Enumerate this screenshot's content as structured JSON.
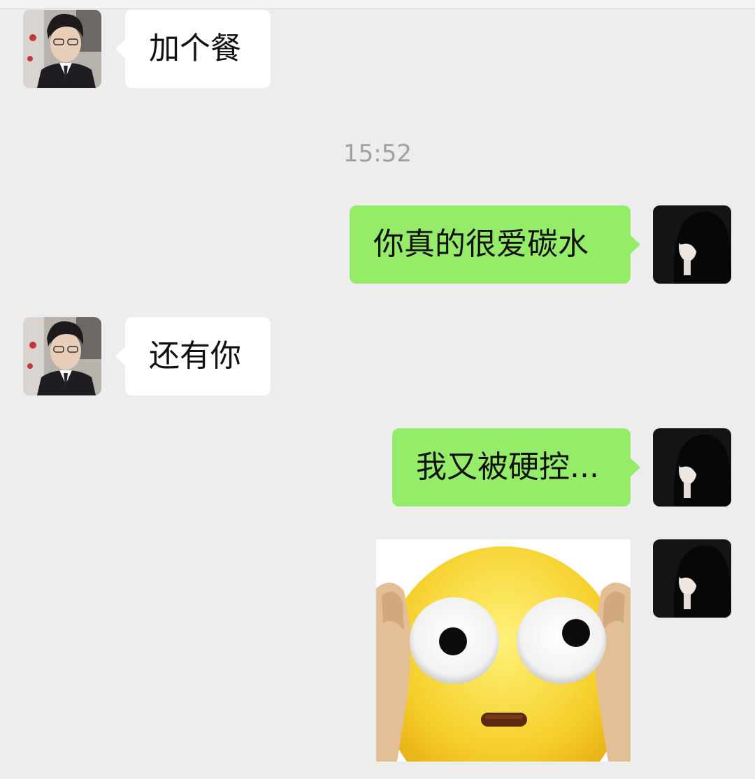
{
  "messages": [
    {
      "side": "left",
      "sender_avatar": "avatar-man-in-suit",
      "text": "加个餐"
    },
    {
      "type": "timestamp",
      "text": "15:52"
    },
    {
      "side": "right",
      "sender_avatar": "avatar-woman-dark-hair",
      "text": "你真的很爱碳水"
    },
    {
      "side": "left",
      "sender_avatar": "avatar-man-in-suit",
      "text": "还有你"
    },
    {
      "side": "right",
      "sender_avatar": "avatar-woman-dark-hair",
      "text": "我又被硬控..."
    },
    {
      "side": "right",
      "sender_avatar": "avatar-woman-dark-hair",
      "type": "sticker",
      "sticker": "shocked-emoji-holding-face"
    }
  ],
  "colors": {
    "background": "#ededed",
    "incoming_bubble": "#ffffff",
    "outgoing_bubble": "#95ec69",
    "timestamp_text": "#a0a0a0"
  }
}
